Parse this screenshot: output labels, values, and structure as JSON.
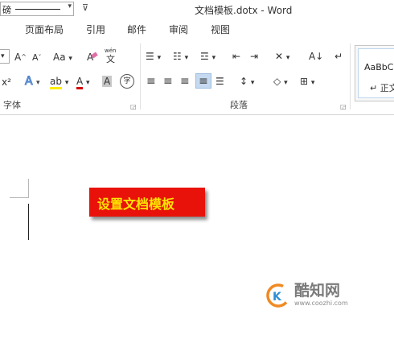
{
  "quick_access": {
    "font_partial": "磅",
    "dropdown": "▾",
    "customize": "⊽"
  },
  "window": {
    "title": "文档模板.dotx - Word"
  },
  "tabs": [
    "页面布局",
    "引用",
    "邮件",
    "审阅",
    "视图"
  ],
  "font_group": {
    "label": "字体",
    "dropdown": "▾",
    "grow_font": "A",
    "grow_sup": "^",
    "shrink_font": "A",
    "shrink_sup": "ˇ",
    "change_case": "Aa",
    "clear_format": "A",
    "phonetic_top": "wén",
    "phonetic": "文",
    "superscript": "x²",
    "text_effects": "A",
    "highlight": "ab",
    "font_color": "A",
    "char_shading": "A",
    "enclose_char": "字"
  },
  "paragraph_group": {
    "label": "段落",
    "bullets": "☰",
    "numbering": "☷",
    "multilevel": "☲",
    "decrease_indent": "⇤",
    "increase_indent": "⇥",
    "chinese_layout": "✕",
    "sort": "A↓",
    "show_marks": "↵",
    "align_left": "≡",
    "align_center": "≡",
    "align_right": "≡",
    "justify": "≡",
    "distributed": "☰",
    "line_spacing": "↕",
    "shading": "◇",
    "borders": "⊞",
    "dropdown": "▾"
  },
  "styles_group": {
    "sample": "AaBbCc",
    "name": "↵ 正文"
  },
  "colors": {
    "accent": "#e8120a",
    "banner_text": "#ffe500",
    "highlight": "#ffee00",
    "font_red": "#d50000",
    "selected": "#c5daf0",
    "logo_orange": "#f08a24",
    "logo_blue": "#2d8fd6"
  },
  "document": {
    "banner_text": "设置文档模板"
  },
  "watermark": {
    "name": "酷知网",
    "url": "www.coozhi.com"
  }
}
